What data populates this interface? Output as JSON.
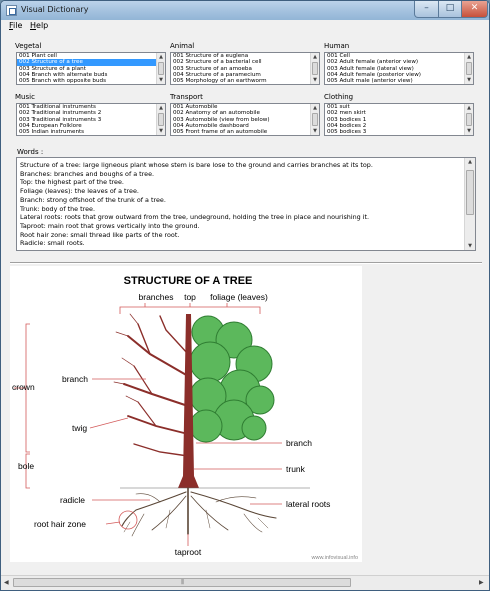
{
  "window": {
    "title": "Visual Dictionary"
  },
  "titlebar_buttons": {
    "minimize": "–",
    "maximize": "□",
    "close": "✕"
  },
  "menu": [
    {
      "label": "File",
      "accel": "F",
      "rest": "ile"
    },
    {
      "label": "Help",
      "accel": "H",
      "rest": "elp"
    }
  ],
  "categories": [
    {
      "title": "Vegetal",
      "items": [
        "001 Plant cell",
        "002 Structure of a tree",
        "003 Structure of a plant",
        "004 Branch with alternate buds",
        "005 Branch with opposite buds"
      ],
      "selected": "002 Structure of a tree"
    },
    {
      "title": "Animal",
      "items": [
        "001 Structure of a euglena",
        "002 Structure of a bacterial cell",
        "003 Structure of an amoeba",
        "004 Structure of a paramecium",
        "005 Morphology of an earthworm"
      ]
    },
    {
      "title": "Human",
      "items": [
        "001 Cell",
        "002 Adult female (anterior view)",
        "003 Adult female (lateral view)",
        "004 Adult female (posterior view)",
        "005 Adult male (anterior view)"
      ]
    },
    {
      "title": "Music",
      "items": [
        "001 Traditional instruments",
        "002 Traditional instruments 2",
        "003 Traditional instruments 3",
        "004 European Folklore",
        "005 Indian instruments"
      ]
    },
    {
      "title": "Transport",
      "items": [
        "001 Automobile",
        "002 Anatomy of an automobile",
        "003 Automobile (view from below)",
        "004 Automobile dashboard",
        "005 Front frame of an automobile"
      ]
    },
    {
      "title": "Clothing",
      "items": [
        "001 suit",
        "002 men skirt",
        "003 bodices 1",
        "004 bodices 2",
        "005 bodices 3"
      ]
    }
  ],
  "words": {
    "label": "Words :",
    "lines": [
      "Structure of a tree: large ligneous plant whose stem is bare lose to the ground and carries branches at its top.",
      "Branches: branches and boughs of a tree.",
      "Top: the highest part of the tree.",
      "Foliage (leaves): the leaves of a tree.",
      "Branch: strong offshoot of the trunk of a tree.",
      "Trunk: body of the tree.",
      "Lateral roots: roots that grow outward from the tree, undeground, holding the tree in place and nourishing it.",
      "Taproot: main root that grows vertically into the ground.",
      "Root hair zone: small thread like parts of the root.",
      "Radicle: small roots."
    ]
  },
  "illustration": {
    "title": "STRUCTURE OF A TREE",
    "labels": {
      "branches": "branches",
      "top": "top",
      "foliage": "foliage (leaves)",
      "crown": "crown",
      "branch_left": "branch",
      "twig": "twig",
      "bole": "bole",
      "radicle": "radicle",
      "root_hair_zone": "root hair zone",
      "taproot": "taproot",
      "branch_right": "branch",
      "trunk": "trunk",
      "lateral_roots": "lateral roots"
    },
    "watermark": "www.infovisual.info"
  },
  "colors": {
    "selection": "#3399ff",
    "foliage": "#5cb85c",
    "foliage_dark": "#2f7d32",
    "trunk": "#8b2e2a",
    "leader": "#d35a5a"
  }
}
